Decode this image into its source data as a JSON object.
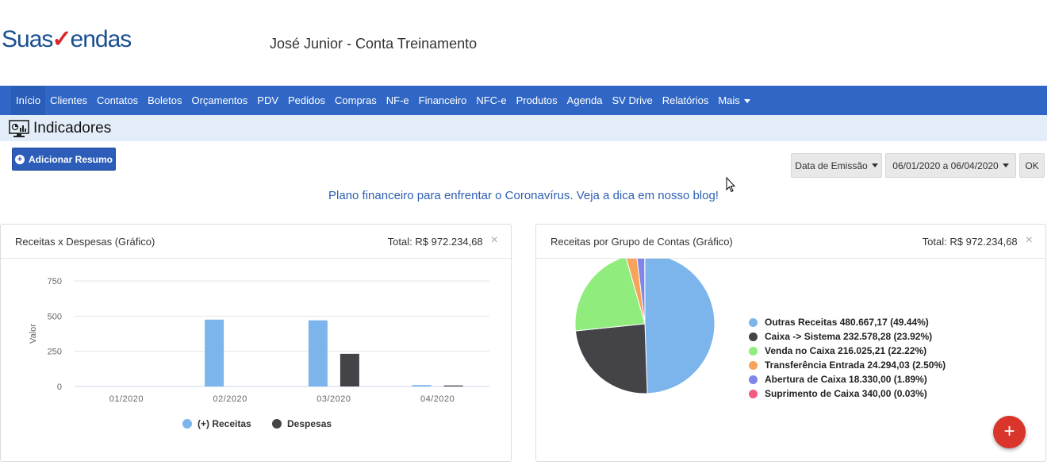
{
  "header": {
    "logo_text_1": "Suas",
    "logo_check": "✓",
    "logo_text_2": "endas",
    "account_title": "José Junior - Conta Treinamento"
  },
  "nav": {
    "items": [
      {
        "label": "Início",
        "active": true
      },
      {
        "label": "Clientes"
      },
      {
        "label": "Contatos"
      },
      {
        "label": "Boletos"
      },
      {
        "label": "Orçamentos"
      },
      {
        "label": "PDV"
      },
      {
        "label": "Pedidos"
      },
      {
        "label": "Compras"
      },
      {
        "label": "NF-e"
      },
      {
        "label": "Financeiro"
      },
      {
        "label": "NFC-e"
      },
      {
        "label": "Produtos"
      },
      {
        "label": "Agenda"
      },
      {
        "label": "SV Drive"
      },
      {
        "label": "Relatórios"
      },
      {
        "label": "Mais",
        "dropdown": true
      }
    ]
  },
  "page": {
    "title": "Indicadores",
    "title_icon": "monitor-chart-icon",
    "add_button_label": "Adicionar Resumo",
    "date_type_label": "Data de Emissão",
    "date_range_label": "06/01/2020 a 06/04/2020",
    "ok_label": "OK",
    "blog_link": "Plano financeiro para enfrentar o Coronavírus. Veja a dica em nosso blog!"
  },
  "panels": {
    "left": {
      "title": "Receitas x Despesas (Gráfico)",
      "total": "Total: R$ 972.234,68",
      "close": "×"
    },
    "right": {
      "title": "Receitas por Grupo de Contas (Gráfico)",
      "total": "Total: R$ 972.234,68",
      "close": "×"
    }
  },
  "fab_label": "+",
  "chart_data": [
    {
      "type": "bar",
      "ylabel": "Valor",
      "ylim": [
        0,
        750
      ],
      "yticks": [
        "0",
        "250",
        "500",
        "750"
      ],
      "categories": [
        "01/2020",
        "02/2020",
        "03/2020",
        "04/2020"
      ],
      "series": [
        {
          "name": "(+) Receitas",
          "color": "#7cb5ec",
          "values": [
            0,
            475,
            470,
            10
          ]
        },
        {
          "name": "Despesas",
          "color": "#434348",
          "values": [
            0,
            0,
            232,
            7
          ]
        }
      ],
      "grid": true,
      "legend": "bottom"
    },
    {
      "type": "pie",
      "legend": "right",
      "slices": [
        {
          "label": "Outras Receitas 480.667,17 (49.44%)",
          "value": 49.44,
          "color": "#7cb5ec"
        },
        {
          "label": "Caixa -> Sistema 232.578,28 (23.92%)",
          "value": 23.92,
          "color": "#434348"
        },
        {
          "label": "Venda no Caixa 216.025,21 (22.22%)",
          "value": 22.22,
          "color": "#90ed7d"
        },
        {
          "label": "Transferência Entrada 24.294,03 (2.50%)",
          "value": 2.5,
          "color": "#f7a35c"
        },
        {
          "label": "Abertura de Caixa 18.330,00 (1.89%)",
          "value": 1.89,
          "color": "#8085e9"
        },
        {
          "label": "Suprimento de Caixa 340,00 (0.03%)",
          "value": 0.03,
          "color": "#f15c80"
        }
      ]
    }
  ]
}
